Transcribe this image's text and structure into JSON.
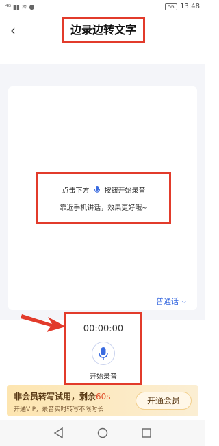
{
  "status_bar": {
    "left_glyphs": [
      "⁴ᴳ",
      "▮▮",
      "≋",
      "●"
    ],
    "battery": "56",
    "time": "13:48"
  },
  "header": {
    "back_icon": "‹",
    "title": "边录边转文字"
  },
  "hint": {
    "line1_pre": "点击下方",
    "line1_post": "按钮开始录音",
    "line2": "靠近手机讲话，效果更好哦~"
  },
  "language": {
    "label": "普通话",
    "chevron": "⌵"
  },
  "record": {
    "timer": "00:00:00",
    "start_label": "开始录音"
  },
  "vip": {
    "title_prefix": "非会员转写试用，剩余",
    "remaining": "60s",
    "subtitle": "开通VIP，录音实时转写不限时长",
    "button": "开通会员"
  },
  "colors": {
    "highlight": "#e23b2b",
    "accent": "#3a6be0",
    "background": "#f4f5f9"
  }
}
